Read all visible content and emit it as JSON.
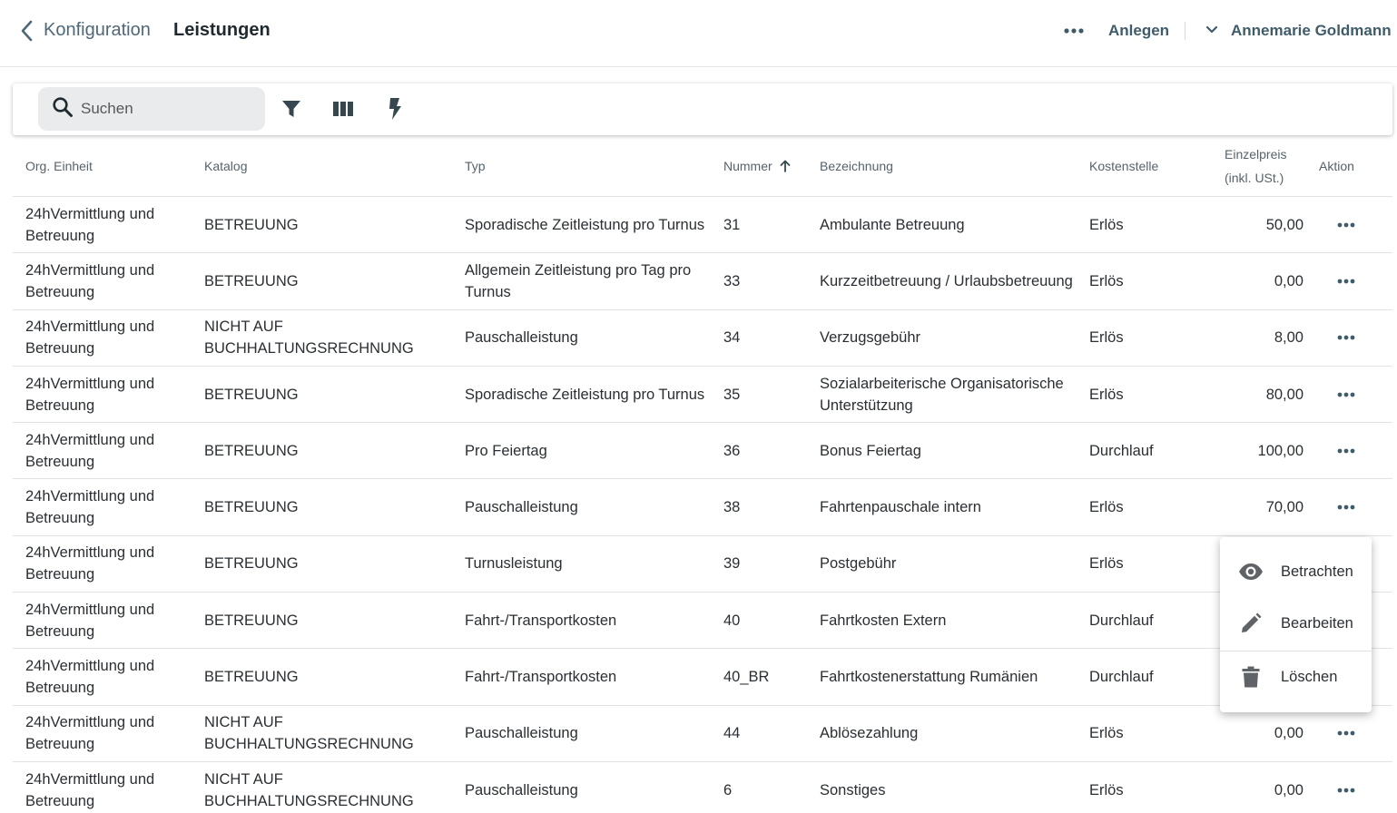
{
  "header": {
    "back_label": "Konfiguration",
    "title": "Leistungen",
    "create_label": "Anlegen",
    "user_name": "Annemarie Goldmann"
  },
  "search": {
    "placeholder": "Suchen"
  },
  "columns": {
    "org": "Org. Einheit",
    "katalog": "Katalog",
    "typ": "Typ",
    "nummer": "Nummer",
    "bezeichnung": "Bezeichnung",
    "kostenstelle": "Kostenstelle",
    "preis_line1": "Einzelpreis",
    "preis_line2": "(inkl. USt.)",
    "aktion": "Aktion"
  },
  "sort": {
    "column": "Nummer",
    "direction": "ascending"
  },
  "rows": [
    {
      "org": "24hVermittlung und Betreuung",
      "katalog": "BETREUUNG",
      "typ": "Sporadische Zeitleistung pro Turnus",
      "nummer": "31",
      "bezeichnung": "Ambulante Betreuung",
      "kostenstelle": "Erlös",
      "preis": "50,00"
    },
    {
      "org": "24hVermittlung und Betreuung",
      "katalog": "BETREUUNG",
      "typ": "Allgemein Zeitleistung pro Tag pro Turnus",
      "nummer": "33",
      "bezeichnung": "Kurzzeitbetreuung / Urlaubsbetreuung",
      "kostenstelle": "Erlös",
      "preis": "0,00"
    },
    {
      "org": "24hVermittlung und Betreuung",
      "katalog": "NICHT AUF BUCHHALTUNGSRECHNUNG",
      "typ": "Pauschalleistung",
      "nummer": "34",
      "bezeichnung": "Verzugsgebühr",
      "kostenstelle": "Erlös",
      "preis": "8,00"
    },
    {
      "org": "24hVermittlung und Betreuung",
      "katalog": "BETREUUNG",
      "typ": "Sporadische Zeitleistung pro Turnus",
      "nummer": "35",
      "bezeichnung": "Sozialarbeiterische Organisatorische Unterstützung",
      "kostenstelle": "Erlös",
      "preis": "80,00"
    },
    {
      "org": "24hVermittlung und Betreuung",
      "katalog": "BETREUUNG",
      "typ": "Pro Feiertag",
      "nummer": "36",
      "bezeichnung": "Bonus Feiertag",
      "kostenstelle": "Durchlauf",
      "preis": "100,00"
    },
    {
      "org": "24hVermittlung und Betreuung",
      "katalog": "BETREUUNG",
      "typ": "Pauschalleistung",
      "nummer": "38",
      "bezeichnung": "Fahrtenpauschale intern",
      "kostenstelle": "Erlös",
      "preis": "70,00"
    },
    {
      "org": "24hVermittlung und Betreuung",
      "katalog": "BETREUUNG",
      "typ": "Turnusleistung",
      "nummer": "39",
      "bezeichnung": "Postgebühr",
      "kostenstelle": "Erlös",
      "preis": ""
    },
    {
      "org": "24hVermittlung und Betreuung",
      "katalog": "BETREUUNG",
      "typ": "Fahrt-/Transportkosten",
      "nummer": "40",
      "bezeichnung": "Fahrtkosten Extern",
      "kostenstelle": "Durchlauf",
      "preis": ""
    },
    {
      "org": "24hVermittlung und Betreuung",
      "katalog": "BETREUUNG",
      "typ": "Fahrt-/Transportkosten",
      "nummer": "40_BR",
      "bezeichnung": "Fahrtkostenerstattung Rumänien",
      "kostenstelle": "Durchlauf",
      "preis": ""
    },
    {
      "org": "24hVermittlung und Betreuung",
      "katalog": "NICHT AUF BUCHHALTUNGSRECHNUNG",
      "typ": "Pauschalleistung",
      "nummer": "44",
      "bezeichnung": "Ablösezahlung",
      "kostenstelle": "Erlös",
      "preis": "0,00"
    },
    {
      "org": "24hVermittlung und Betreuung",
      "katalog": "NICHT AUF BUCHHALTUNGSRECHNUNG",
      "typ": "Pauschalleistung",
      "nummer": "6",
      "bezeichnung": "Sonstiges",
      "kostenstelle": "Erlös",
      "preis": "0,00"
    }
  ],
  "context_menu": {
    "view_label": "Betrachten",
    "edit_label": "Bearbeiten",
    "delete_label": "Löschen"
  },
  "colors": {
    "accent": "#3f5c6b",
    "icon": "#37474f",
    "search_bg": "#eaebec"
  }
}
